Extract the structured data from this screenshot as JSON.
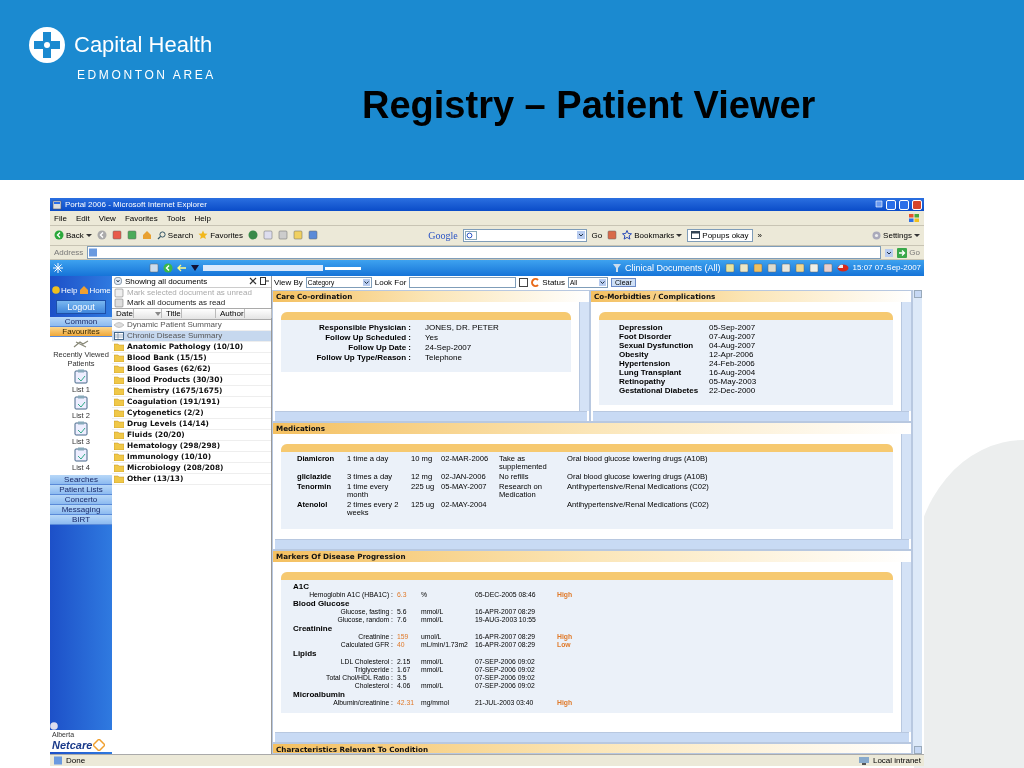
{
  "slide": {
    "logo_name": "Capital Health",
    "logo_subtitle": "EDMONTON AREA",
    "title": "Registry – Patient Viewer"
  },
  "window": {
    "title": "Portal 2006 - Microsoft Internet Explorer"
  },
  "menu": [
    "File",
    "Edit",
    "View",
    "Favorites",
    "Tools",
    "Help"
  ],
  "toolbar": {
    "back": "Back",
    "search": "Search",
    "favorites": "Favorites",
    "google": "Google",
    "go": "Go",
    "bookmarks": "Bookmarks",
    "popups": "Popups okay",
    "more": "»",
    "settings": "Settings"
  },
  "address": {
    "label": "Address",
    "go": "Go"
  },
  "app_bar": {
    "documents": "Clinical Documents (All)",
    "datetime": "15:07 07-Sep-2007"
  },
  "sidebar": {
    "help": "Help",
    "home": "Home",
    "logout": "Logout",
    "sections": [
      {
        "label": "Common",
        "selected": false
      },
      {
        "label": "Favourites",
        "selected": true
      },
      {
        "label": "Searches",
        "selected": false
      },
      {
        "label": "Patient Lists",
        "selected": false
      },
      {
        "label": "Concerto",
        "selected": false
      },
      {
        "label": "Messaging",
        "selected": false
      },
      {
        "label": "BIRT",
        "selected": false
      }
    ],
    "recent": "Recently Viewed Patients",
    "lists": [
      "List 1",
      "List 2",
      "List 3",
      "List 4"
    ],
    "brand_top": "Alberta",
    "brand": "Netcare"
  },
  "documents": {
    "filter": "Showing all documents",
    "actions": [
      {
        "label": "Mark selected document as unread",
        "disabled": true
      },
      {
        "label": "Mark all documents as read",
        "disabled": false
      }
    ],
    "columns": [
      "Date",
      "Title",
      "Author"
    ],
    "items": [
      {
        "kind": "document",
        "title": "Dynamic Patient Summary",
        "selected": false
      },
      {
        "kind": "summary",
        "title": "Chronic Disease Summary",
        "selected": true
      },
      {
        "kind": "folder",
        "title": "Anatomic Pathology",
        "count": "(10/10)",
        "selected": false
      },
      {
        "kind": "folder",
        "title": "Blood Bank",
        "count": "(15/15)",
        "selected": false
      },
      {
        "kind": "folder",
        "title": "Blood Gases",
        "count": "(62/62)",
        "selected": false
      },
      {
        "kind": "folder",
        "title": "Blood Products",
        "count": "(30/30)",
        "selected": false
      },
      {
        "kind": "folder",
        "title": "Chemistry",
        "count": "(1675/1675)",
        "selected": false
      },
      {
        "kind": "folder",
        "title": "Coagulation",
        "count": "(191/191)",
        "selected": false
      },
      {
        "kind": "folder",
        "title": "Cytogenetics",
        "count": "(2/2)",
        "selected": false
      },
      {
        "kind": "folder",
        "title": "Drug Levels",
        "count": "(14/14)",
        "selected": false
      },
      {
        "kind": "folder",
        "title": "Fluids",
        "count": "(20/20)",
        "selected": false
      },
      {
        "kind": "folder",
        "title": "Hematology",
        "count": "(298/298)",
        "selected": false
      },
      {
        "kind": "folder",
        "title": "Immunology",
        "count": "(10/10)",
        "selected": false
      },
      {
        "kind": "folder",
        "title": "Microbiology",
        "count": "(208/208)",
        "selected": false
      },
      {
        "kind": "folder",
        "title": "Other",
        "count": "(13/13)",
        "selected": false
      }
    ]
  },
  "filters": {
    "view_by_label": "View By",
    "view_by": "Category",
    "look_for_label": "Look For",
    "checked": false,
    "status_label": "Status",
    "status": "All",
    "clear": "Clear"
  },
  "care": {
    "title": "Care Co-ordination",
    "rows": [
      {
        "label": "Responsible Physician :",
        "value": "JONES, DR. PETER"
      },
      {
        "label": "Follow Up Scheduled :",
        "value": "Yes"
      },
      {
        "label": "Follow Up Date :",
        "value": "24-Sep-2007"
      },
      {
        "label": "Follow Up Type/Reason :",
        "value": "Telephone"
      }
    ]
  },
  "comorbidities": {
    "title": "Co-Morbidties / Complications",
    "rows": [
      {
        "condition": "Depression",
        "date": "05-Sep-2007"
      },
      {
        "condition": "Foot Disorder",
        "date": "07-Aug-2007"
      },
      {
        "condition": "Sexual Dysfunction",
        "date": "04-Aug-2007"
      },
      {
        "condition": "Obesity",
        "date": "12-Apr-2006"
      },
      {
        "condition": "Hypertension",
        "date": "24-Feb-2006"
      },
      {
        "condition": "Lung Transplant",
        "date": "16-Aug-2004"
      },
      {
        "condition": "Retinopathy",
        "date": "05-May-2003"
      },
      {
        "condition": "Gestational Diabetes",
        "date": "22-Dec-2000"
      }
    ]
  },
  "medications": {
    "title": "Medications",
    "rows": [
      {
        "name": "Diamicron",
        "frequency": "1 time a day",
        "dose": "10 mg",
        "date": "02-MAR-2006",
        "note": "Take as supplemented",
        "drug_class": "Oral blood glucose lowering drugs (A10B)"
      },
      {
        "name": "gliclazide",
        "frequency": "3 times a day",
        "dose": "12 mg",
        "date": "02-JAN-2006",
        "note": "No refills",
        "drug_class": "Oral blood glucose lowering drugs (A10B)"
      },
      {
        "name": "Tenormin",
        "frequency": "1 time every month",
        "dose": "225 ug",
        "date": "05-MAY-2007",
        "note": "Research on Medication",
        "drug_class": "Antihypertensive/Renal Medications (C02)"
      },
      {
        "name": "Atenolol",
        "frequency": "2 times every 2 weeks",
        "dose": "125 ug",
        "date": "02-MAY-2004",
        "drug_class": "Antihypertensive/Renal Medications (C02)"
      }
    ]
  },
  "markers": {
    "title": "Markers Of Disease Progression",
    "groups": [
      {
        "name": "A1C",
        "rows": [
          {
            "label": "Hemoglobin A1C (HBA1C) :",
            "value": "6.3",
            "unit": "%",
            "date": "05-DEC-2005 08:46",
            "flag": "High"
          }
        ]
      },
      {
        "name": "Blood Glucose",
        "rows": [
          {
            "label": "Glucose, fasting :",
            "value": "5.6",
            "unit": "mmol/L",
            "date": "16-APR-2007 08:29"
          },
          {
            "label": "Glucose, random :",
            "value": "7.6",
            "unit": "mmol/L",
            "date": "19-AUG-2003 10:55"
          }
        ]
      },
      {
        "name": "Creatinine",
        "rows": [
          {
            "label": "Creatinine :",
            "value": "159",
            "unit": "umol/L",
            "date": "16-APR-2007 08:29",
            "flag": "High"
          },
          {
            "label": "Calculated GFR :",
            "value": "40",
            "unit": "mL/min/1.73m2",
            "date": "16-APR-2007 08:29",
            "flag": "Low"
          }
        ]
      },
      {
        "name": "Lipids",
        "rows": [
          {
            "label": "LDL Cholesterol :",
            "value": "2.15",
            "unit": "mmol/L",
            "date": "07-SEP-2006 09:02"
          },
          {
            "label": "Triglyceride :",
            "value": "1.67",
            "unit": "mmol/L",
            "date": "07-SEP-2006 09:02"
          },
          {
            "label": "Total Chol/HDL Ratio :",
            "value": "3.5",
            "date": "07-SEP-2006 09:02"
          },
          {
            "label": "Cholesterol :",
            "value": "4.06",
            "unit": "mmol/L",
            "date": "07-SEP-2006 09:02"
          }
        ]
      },
      {
        "name": "Microalbumin",
        "rows": [
          {
            "label": "Albumin/creatinine :",
            "value": "42.31",
            "unit": "mg/mmol",
            "date": "21-JUL-2003 03:40",
            "flag": "High"
          }
        ]
      }
    ]
  },
  "next_section": {
    "title": "Characteristics Relevant To Condition"
  },
  "status_bar": {
    "text": "Done",
    "zone": "Local intranet"
  }
}
